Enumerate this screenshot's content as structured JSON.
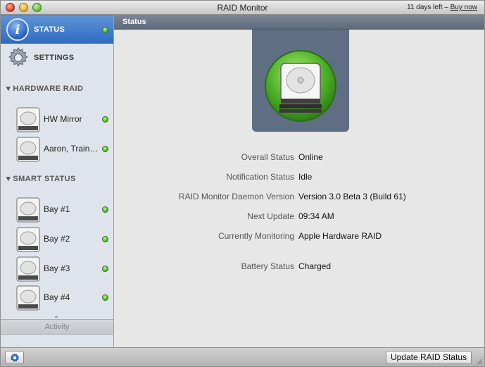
{
  "window": {
    "title": "RAID Monitor",
    "trial_text": "11 days left –",
    "buy_link": "Buy now"
  },
  "sidebar": {
    "status_label": "STATUS",
    "settings_label": "SETTINGS",
    "hardware_raid_header": "▾ HARDWARE RAID",
    "hardware_raid_items": [
      {
        "label": "HW Mirror",
        "status": "ok"
      },
      {
        "label": "Aaron, Train …",
        "status": "ok"
      }
    ],
    "smart_status_header": "▾ SMART STATUS",
    "smart_items": [
      {
        "label": "Bay #1",
        "status": "ok"
      },
      {
        "label": "Bay #2",
        "status": "ok"
      },
      {
        "label": "Bay #3",
        "status": "ok"
      },
      {
        "label": "Bay #4",
        "status": "ok"
      }
    ],
    "activity_label": "Activity"
  },
  "main": {
    "header_title": "Status",
    "rows": [
      {
        "key": "Overall Status",
        "value": "Online"
      },
      {
        "key": "Notification Status",
        "value": "Idle"
      },
      {
        "key": "RAID Monitor Daemon Version",
        "value": "Version 3.0 Beta 3 (Build 61)"
      },
      {
        "key": "Next Update",
        "value": "09:34 AM"
      },
      {
        "key": "Currently Monitoring",
        "value": "Apple Hardware RAID"
      },
      {
        "key": "Battery Status",
        "value": "Charged"
      }
    ]
  },
  "bottombar": {
    "update_button_label": "Update RAID Status"
  },
  "colors": {
    "selection_blue": "#2f6ac2",
    "status_green": "#48b52a",
    "header_slate": "#5e6a79"
  }
}
